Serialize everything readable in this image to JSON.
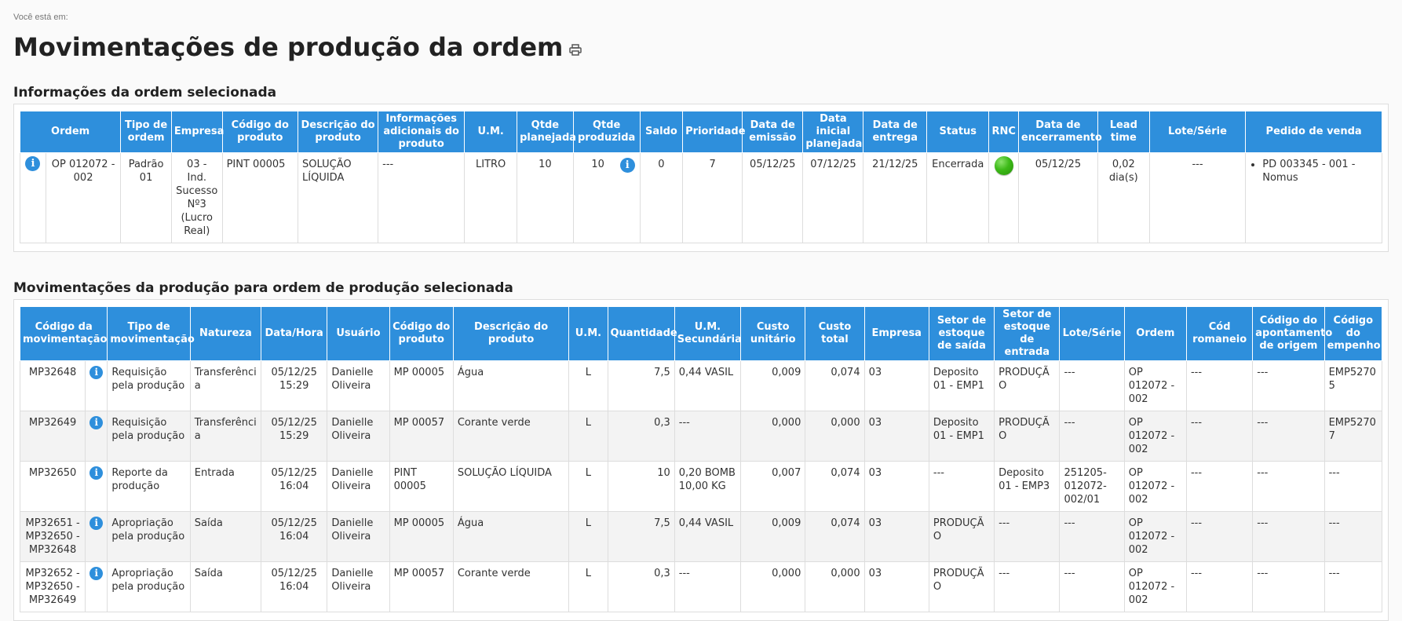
{
  "breadcrumb": {
    "label": "Você está em:"
  },
  "page": {
    "title": "Movimentações de produção da ordem"
  },
  "section_order": {
    "title": "Informações da ordem selecionada"
  },
  "section_moves": {
    "title": "Movimentações da produção para ordem de produção selecionada"
  },
  "order_table": {
    "headers": {
      "ordem": "Ordem",
      "tipo": "Tipo de ordem",
      "empresa": "Empresa",
      "codigo": "Código do produto",
      "descricao": "Descrição do produto",
      "info": "Informações adicionais do produto",
      "um": "U.M.",
      "qtde_plan": "Qtde planejada",
      "qtde_prod": "Qtde produzida",
      "saldo": "Saldo",
      "prioridade": "Prioridade",
      "emissao": "Data de emissão",
      "inicial": "Data inicial planejada",
      "entrega": "Data de entrega",
      "status": "Status",
      "rnc": "RNC",
      "encerramento": "Data de encerramento",
      "lead": "Lead time",
      "lote": "Lote/Série",
      "pedido": "Pedido de venda"
    },
    "row": {
      "ordem": "OP 012072 - 002",
      "tipo": "Padrão 01",
      "empresa": "03 - Ind. Sucesso Nº3 (Lucro Real)",
      "codigo": "PINT 00005",
      "descricao": "SOLUÇÃO LÍQUIDA",
      "info": "---",
      "um": "LITRO",
      "qtde_plan": "10",
      "qtde_prod": "10",
      "saldo": "0",
      "prioridade": "7",
      "emissao": "05/12/25",
      "inicial": "07/12/25",
      "entrega": "21/12/25",
      "status": "Encerrada",
      "rnc_color": "#3dba18",
      "encerramento": "05/12/25",
      "lead": "0,02 dia(s)",
      "lote": "---",
      "pedido": "PD 003345 - 001 - Nomus"
    }
  },
  "moves_table": {
    "headers": {
      "codigo_mov": "Código da movimentação",
      "tipo_mov": "Tipo de movimentação",
      "natureza": "Natureza",
      "data_hora": "Data/Hora",
      "usuario": "Usuário",
      "codigo_prod": "Código do produto",
      "descricao": "Descrição do produto",
      "um": "U.M.",
      "quantidade": "Quantidade",
      "um_sec": "U.M. Secundária",
      "custo_unit": "Custo unitário",
      "custo_total": "Custo total",
      "empresa": "Empresa",
      "setor_saida": "Setor de estoque de saída",
      "setor_entrada": "Setor de estoque de entrada",
      "lote": "Lote/Série",
      "ordem": "Ordem",
      "romaneio": "Cód romaneio",
      "apontamento": "Código do apontamento de origem",
      "empenho": "Código do empenho"
    },
    "rows": [
      {
        "codigo_mov": "MP32648",
        "tipo_mov": "Requisição pela produção",
        "natureza": "Transferência",
        "data_hora": "05/12/25 15:29",
        "usuario": "Danielle Oliveira",
        "codigo_prod": "MP 00005",
        "descricao": "Água",
        "um": "L",
        "quantidade": "7,5",
        "um_sec": "0,44 VASIL",
        "custo_unit": "0,009",
        "custo_total": "0,074",
        "empresa": "03",
        "setor_saida": "Deposito 01 - EMP1",
        "setor_entrada": "PRODUÇÃO",
        "lote": "---",
        "ordem": "OP 012072 - 002",
        "romaneio": "---",
        "apontamento": "---",
        "empenho": "EMP52705"
      },
      {
        "codigo_mov": "MP32649",
        "tipo_mov": "Requisição pela produção",
        "natureza": "Transferência",
        "data_hora": "05/12/25 15:29",
        "usuario": "Danielle Oliveira",
        "codigo_prod": "MP 00057",
        "descricao": "Corante verde",
        "um": "L",
        "quantidade": "0,3",
        "um_sec": "---",
        "custo_unit": "0,000",
        "custo_total": "0,000",
        "empresa": "03",
        "setor_saida": "Deposito 01 - EMP1",
        "setor_entrada": "PRODUÇÃO",
        "lote": "---",
        "ordem": "OP 012072 - 002",
        "romaneio": "---",
        "apontamento": "---",
        "empenho": "EMP52707"
      },
      {
        "codigo_mov": "MP32650",
        "tipo_mov": "Reporte da produção",
        "natureza": "Entrada",
        "data_hora": "05/12/25 16:04",
        "usuario": "Danielle Oliveira",
        "codigo_prod": "PINT 00005",
        "descricao": "SOLUÇÃO LÍQUIDA",
        "um": "L",
        "quantidade": "10",
        "um_sec": "0,20 BOMB 10,00 KG",
        "custo_unit": "0,007",
        "custo_total": "0,074",
        "empresa": "03",
        "setor_saida": "---",
        "setor_entrada": "Deposito 01 - EMP3",
        "lote": "251205-012072-002/01",
        "ordem": "OP 012072 - 002",
        "romaneio": "---",
        "apontamento": "---",
        "empenho": "---"
      },
      {
        "codigo_mov": "MP32651 - MP32650 - MP32648",
        "tipo_mov": "Apropriação pela produção",
        "natureza": "Saída",
        "data_hora": "05/12/25 16:04",
        "usuario": "Danielle Oliveira",
        "codigo_prod": "MP 00005",
        "descricao": "Água",
        "um": "L",
        "quantidade": "7,5",
        "um_sec": "0,44 VASIL",
        "custo_unit": "0,009",
        "custo_total": "0,074",
        "empresa": "03",
        "setor_saida": "PRODUÇÃO",
        "setor_entrada": "---",
        "lote": "---",
        "ordem": "OP 012072 - 002",
        "romaneio": "---",
        "apontamento": "---",
        "empenho": "---"
      },
      {
        "codigo_mov": "MP32652 - MP32650 - MP32649",
        "tipo_mov": "Apropriação pela produção",
        "natureza": "Saída",
        "data_hora": "05/12/25 16:04",
        "usuario": "Danielle Oliveira",
        "codigo_prod": "MP 00057",
        "descricao": "Corante verde",
        "um": "L",
        "quantidade": "0,3",
        "um_sec": "---",
        "custo_unit": "0,000",
        "custo_total": "0,000",
        "empresa": "03",
        "setor_saida": "PRODUÇÃO",
        "setor_entrada": "---",
        "lote": "---",
        "ordem": "OP 012072 - 002",
        "romaneio": "---",
        "apontamento": "---",
        "empenho": "---"
      }
    ]
  },
  "icons": {
    "info": "info-icon",
    "print": "print-icon",
    "rnc": "status-dot-icon"
  },
  "colors": {
    "header_bg": "#2e8fdc",
    "accent": "#2e8fdc",
    "rnc_ok": "#3dba18"
  }
}
